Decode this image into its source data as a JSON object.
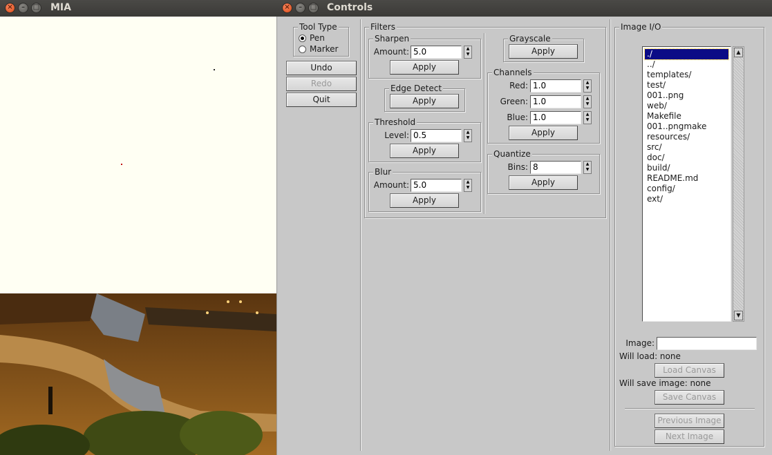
{
  "mia_window": {
    "title": "MIA"
  },
  "controls_window": {
    "title": "Controls"
  },
  "tool_type": {
    "legend": "Tool Type",
    "options": [
      {
        "label": "Pen",
        "checked": true
      },
      {
        "label": "Marker",
        "checked": false
      }
    ]
  },
  "history": {
    "undo": "Undo",
    "redo": "Redo",
    "quit": "Quit"
  },
  "filters": {
    "legend": "Filters",
    "sharpen": {
      "legend": "Sharpen",
      "label": "Amount:",
      "value": "5.0",
      "apply": "Apply"
    },
    "edge_detect": {
      "legend": "Edge Detect",
      "apply": "Apply"
    },
    "threshold": {
      "legend": "Threshold",
      "label": "Level:",
      "value": "0.5",
      "apply": "Apply"
    },
    "blur": {
      "legend": "Blur",
      "label": "Amount:",
      "value": "5.0",
      "apply": "Apply"
    },
    "grayscale": {
      "legend": "Grayscale",
      "apply": "Apply"
    },
    "channels": {
      "legend": "Channels",
      "red_label": "Red:",
      "red_value": "1.0",
      "green_label": "Green:",
      "green_value": "1.0",
      "blue_label": "Blue:",
      "blue_value": "1.0",
      "apply": "Apply"
    },
    "quantize": {
      "legend": "Quantize",
      "label": "Bins:",
      "value": "8",
      "apply": "Apply"
    }
  },
  "image_io": {
    "legend": "Image I/O",
    "files": [
      "./",
      "../",
      "templates/",
      "test/",
      "001..png",
      "web/",
      "Makefile",
      "001..pngmake",
      "resources/",
      "src/",
      "doc/",
      "build/",
      "README.md",
      "config/",
      "ext/"
    ],
    "selected_index": 0,
    "image_label": "Image:",
    "image_value": "",
    "will_load": "Will load: none",
    "load_canvas": "Load Canvas",
    "will_save": "Will save image: none",
    "save_canvas": "Save Canvas",
    "previous_image": "Previous Image",
    "next_image": "Next Image"
  },
  "colors": {
    "canvas_bg": "#fffff3",
    "panel_bg": "#c8c8c8",
    "selection": "#0b0b86",
    "close_button": "#df4b16"
  }
}
